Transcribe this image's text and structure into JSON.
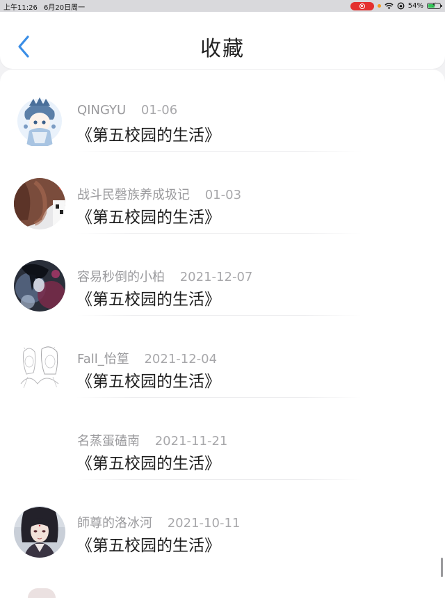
{
  "status_bar": {
    "time": "上午11:26",
    "date": "6月20日周一",
    "battery": "54%",
    "battery_level": 0.54,
    "icons": [
      "screen-record-icon",
      "wifi-icon",
      "rotation-lock-icon",
      "battery-icon"
    ]
  },
  "header": {
    "title": "收藏",
    "back_icon": "chevron-left-icon",
    "accent_color": "#3a8ee6"
  },
  "favorites": [
    {
      "user": "QINGYU",
      "date": "01-06",
      "title": "《第五校园的生活》",
      "avatar": "anime-chibi-avatar"
    },
    {
      "user": "战斗民磬族养成圾记",
      "date": "01-03",
      "title": "《第五校园的生活》",
      "avatar": "hair-photo-avatar"
    },
    {
      "user": "容易秒倒的小柏",
      "date": "2021-12-07",
      "title": "《第五校园的生活》",
      "avatar": "dark-anime-avatar"
    },
    {
      "user": "Fall_怡篁",
      "date": "2021-12-04",
      "title": "《第五校园的生活》",
      "avatar": "sketch-anime-avatar"
    },
    {
      "user": "名蒸蛋磕南",
      "date": "2021-11-21",
      "title": "《第五校园的生活》",
      "avatar": "blank-avatar"
    },
    {
      "user": "師尊的洛冰河",
      "date": "2021-10-11",
      "title": "《第五校园的生活》",
      "avatar": "anime-portrait-avatar"
    }
  ]
}
